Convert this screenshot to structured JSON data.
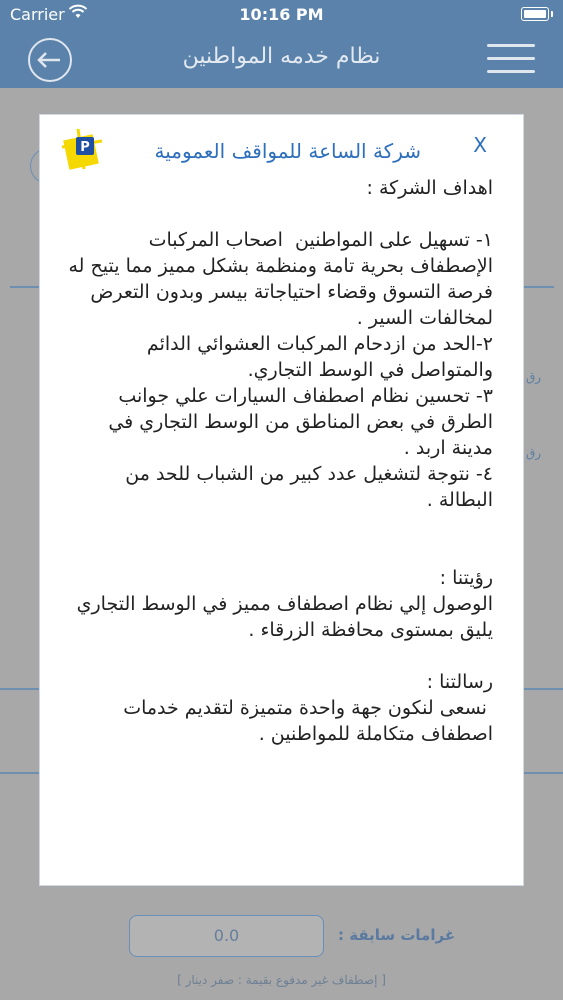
{
  "status": {
    "carrier": "Carrier",
    "time": "10:16 PM"
  },
  "nav": {
    "title": "نظام خدمه المواطنين"
  },
  "modal": {
    "title": "شركة الساعة للمواقف العمومية",
    "close": "X",
    "body": "اهداف الشركة :\n\n١- تسهيل على المواطنين  اصحاب المركبات الإصطفاف بحرية تامة ومنظمة بشكل مميز مما يتيح له فرصة التسوق وقضاء احتياجاتة بيسر وبدون التعرض لمخالفات السير .\n٢-الحد من ازدحام المركبات العشوائي الدائم والمتواصل في الوسط التجاري.\n٣- تحسين نظام اصطفاف السيارات علي جوانب الطرق في بعض المناطق من الوسط التجاري في مدينة اربد .\n٤- نتوجة لتشغيل عدد كبير من الشباب للحد من البطالة .\n\n\nرؤيتنا :\nالوصول إلي نظام اصطفاف مميز في الوسط التجاري يليق بمستوى محافظة الزرقاء .\n\nرسالتنا :\n نسعى لنكون جهة واحدة متميزة لتقديم خدمات اصطفاف متكاملة للمواطنين ."
  },
  "background": {
    "side_label_1": "رق",
    "side_label_2": "رق",
    "fines_label": "غرامات سابقة :",
    "fines_value": "0.0",
    "unpaid_note": "[   إصطفاف غير مدفوع بقيمة : صفر دينار  ]"
  },
  "colors": {
    "nav_bar": "#5a82aa",
    "modal_title": "#2e6fbd",
    "overlay": "#a8a8a8"
  }
}
